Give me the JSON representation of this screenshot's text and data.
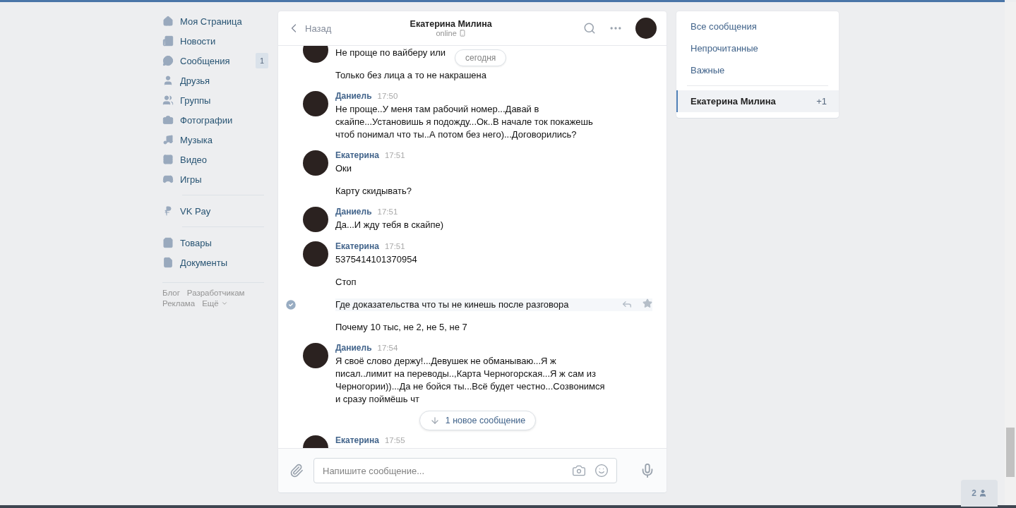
{
  "nav": {
    "groups": [
      [
        {
          "label": "Моя Страница"
        },
        {
          "label": "Новости"
        },
        {
          "label": "Сообщения",
          "count": "1"
        },
        {
          "label": "Друзья"
        },
        {
          "label": "Группы"
        },
        {
          "label": "Фотографии"
        },
        {
          "label": "Музыка"
        },
        {
          "label": "Видео"
        },
        {
          "label": "Игры"
        }
      ],
      [
        {
          "label": "VK Pay"
        }
      ],
      [
        {
          "label": "Товары"
        },
        {
          "label": "Документы"
        }
      ]
    ],
    "footer_links": [
      "Блог",
      "Разработчикам",
      "Реклама",
      "Ещё"
    ]
  },
  "chat": {
    "back": "Назад",
    "title": "Екатерина Милина",
    "status": "online",
    "date_divider": "сегодня",
    "messages": [
      {
        "lines": [
          {
            "text": "Не проще по вайберу или",
            "selected": false
          },
          {
            "text": "Только без лица а то не накрашена",
            "selected": false
          }
        ]
      },
      {
        "author": "Даниель",
        "time": "17:50",
        "lines": [
          {
            "text": "Не проще..У меня там рабочий номер...Давай в скайпе...Установишь я подожду...Ок..В начале ток покажешь чтоб понимал что ты..А потом без него)...Договорились?",
            "selected": false
          }
        ]
      },
      {
        "author": "Екатерина",
        "time": "17:51",
        "lines": [
          {
            "text": "Оки",
            "selected": false
          },
          {
            "text": "Карту скидывать?",
            "selected": false
          }
        ]
      },
      {
        "author": "Даниель",
        "time": "17:51",
        "lines": [
          {
            "text": "Да...И жду тебя в скайпе)",
            "selected": false
          }
        ]
      },
      {
        "author": "Екатерина",
        "time": "17:51",
        "lines": [
          {
            "text": "5375414101370954",
            "selected": false
          },
          {
            "text": "Стоп",
            "selected": false
          },
          {
            "text": "Где доказательства что ты не кинешь после разговора",
            "selected": true
          },
          {
            "text": "Почему 10 тыс, не 2, не 5, не 7",
            "selected": false
          }
        ]
      },
      {
        "author": "Даниель",
        "time": "17:54",
        "lines": [
          {
            "text": "Я своё слово держу!...Девушек не обманываю...Я ж писал..лимит на переводы..,Карта Черногорская...Я ж сам из Черногории))...Да не бойся ты...Всё будет честно...Созвонимся и сразу поймёшь чт",
            "selected": false
          }
        ]
      },
      {
        "author": "Екатерина",
        "time": "17:55"
      }
    ],
    "new_messages": "1 новое сообщение",
    "composer": {
      "placeholder": "Напишите сообщение..."
    }
  },
  "filters": [
    {
      "label": "Все сообщения",
      "selected": false
    },
    {
      "label": "Непрочитанные",
      "selected": false
    },
    {
      "label": "Важные",
      "selected": false
    }
  ],
  "conversations": [
    {
      "name": "Екатерина Милина",
      "count": "+1",
      "selected": true
    }
  ],
  "online_friends": "2"
}
